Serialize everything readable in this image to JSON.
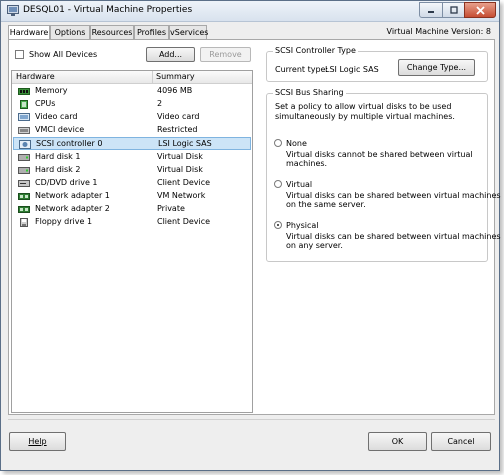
{
  "window": {
    "title": "DESQL01 - Virtual Machine Properties",
    "version_label": "Virtual Machine Version: 8"
  },
  "tabs": [
    {
      "label": "Hardware",
      "active": true
    },
    {
      "label": "Options"
    },
    {
      "label": "Resources"
    },
    {
      "label": "Profiles"
    },
    {
      "label": "vServices"
    }
  ],
  "hardware": {
    "show_all_devices": "Show All Devices",
    "add_button": "Add...",
    "remove_button": "Remove",
    "columns": {
      "hardware": "Hardware",
      "summary": "Summary"
    },
    "items": [
      {
        "name": "Memory",
        "summary": "4096 MB",
        "icon": "memory-icon"
      },
      {
        "name": "CPUs",
        "summary": "2",
        "icon": "cpu-icon"
      },
      {
        "name": "Video card",
        "summary": "Video card",
        "icon": "video-card-icon"
      },
      {
        "name": "VMCI device",
        "summary": "Restricted",
        "icon": "vmci-device-icon"
      },
      {
        "name": "SCSI controller 0",
        "summary": "LSI Logic SAS",
        "icon": "scsi-controller-icon",
        "selected": true
      },
      {
        "name": "Hard disk 1",
        "summary": "Virtual Disk",
        "icon": "hard-disk-icon"
      },
      {
        "name": "Hard disk 2",
        "summary": "Virtual Disk",
        "icon": "hard-disk-icon"
      },
      {
        "name": "CD/DVD drive 1",
        "summary": "Client Device",
        "icon": "cd-dvd-icon"
      },
      {
        "name": "Network adapter 1",
        "summary": "VM Network",
        "icon": "network-adapter-icon"
      },
      {
        "name": "Network adapter 2",
        "summary": "Private",
        "icon": "network-adapter-icon"
      },
      {
        "name": "Floppy drive 1",
        "summary": "Client Device",
        "icon": "floppy-icon"
      }
    ]
  },
  "scsi_type": {
    "group_title": "SCSI Controller Type",
    "current_label": "Current type:",
    "current_value": "LSI Logic SAS",
    "change_button": "Change Type..."
  },
  "bus_sharing": {
    "group_title": "SCSI Bus Sharing",
    "description_line1": "Set a policy to allow virtual disks to be used",
    "description_line2": "simultaneously by multiple virtual machines.",
    "options": [
      {
        "label": "None",
        "desc1": "Virtual disks cannot be shared between virtual",
        "desc2": "machines.",
        "selected": false
      },
      {
        "label": "Virtual",
        "desc1": "Virtual disks can be shared between virtual machines",
        "desc2": "on the same server.",
        "selected": false
      },
      {
        "label": "Physical",
        "desc1": "Virtual disks can be shared between virtual machines",
        "desc2": "on any server.",
        "selected": true
      }
    ]
  },
  "footer": {
    "help_button": "Help",
    "ok_button": "OK",
    "cancel_button": "Cancel"
  },
  "colors": {
    "selection": "#cce4f7",
    "selection_border": "#7fb4e0",
    "window_border": "#5b6f88",
    "close_button": "#c64d33"
  }
}
